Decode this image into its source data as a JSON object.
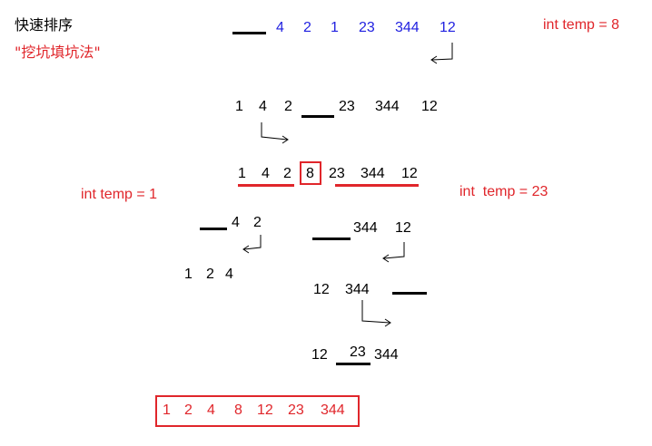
{
  "title": "快速排序",
  "subtitle": "\"挖坑填坑法\"",
  "temps": {
    "top": "int temp = 8",
    "left": "int temp = 1",
    "right": "int  temp = 23"
  },
  "rows": {
    "r1": [
      "4",
      "2",
      "1",
      "23",
      "344",
      "12"
    ],
    "r2a": [
      "1",
      "4",
      "2"
    ],
    "r2b": [
      "23",
      "344",
      "12"
    ],
    "r3a": [
      "1",
      "4",
      "2"
    ],
    "r3pivot": "8",
    "r3b": [
      "23",
      "344",
      "12"
    ],
    "l1": [
      "4",
      "2"
    ],
    "l2": [
      "1",
      "2",
      "4"
    ],
    "rr1": [
      "344",
      "12"
    ],
    "rr2": [
      "12",
      "344"
    ],
    "rr3a": "12",
    "rr3b": "23",
    "rr3c": "344"
  },
  "final": [
    "1",
    "2",
    "4",
    "8",
    "12",
    "23",
    "344"
  ],
  "colors": {
    "red": "#e0262b",
    "blue": "#1f1fe0",
    "black": "#000000"
  }
}
